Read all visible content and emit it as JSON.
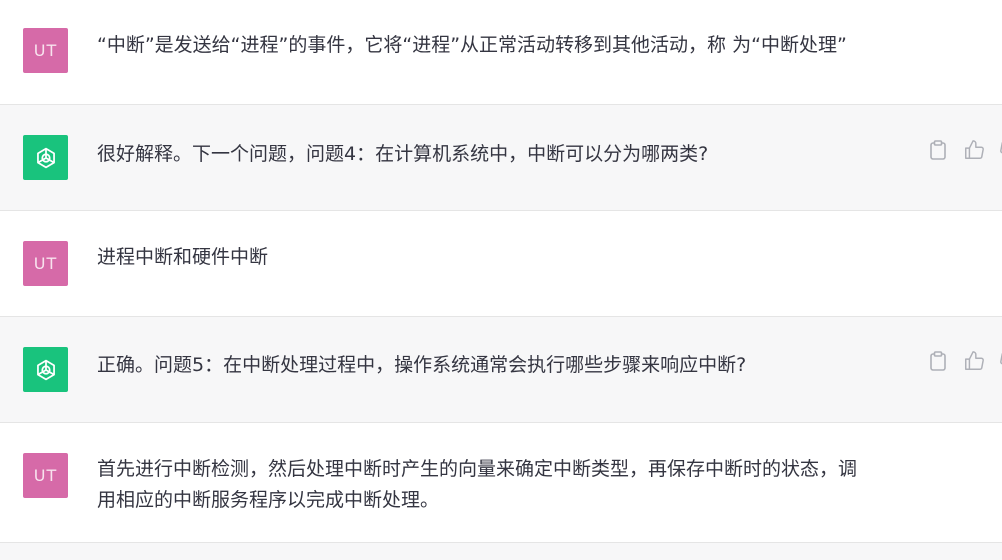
{
  "conversation": {
    "messages": [
      {
        "role": "user",
        "avatar_initials": "UT",
        "text": "“中断”是发送给“进程”的事件，它将“进程”从正常活动转移到其他活动，称 为“中断处理”"
      },
      {
        "role": "assistant",
        "avatar_icon": "openai-logo-icon",
        "text": "很好解释。下一个问题，问题4：在计算机系统中，中断可以分为哪两类?"
      },
      {
        "role": "user",
        "avatar_initials": "UT",
        "text": "进程中断和硬件中断"
      },
      {
        "role": "assistant",
        "avatar_icon": "openai-logo-icon",
        "text": "正确。问题5：在中断处理过程中，操作系统通常会执行哪些步骤来响应中断?"
      },
      {
        "role": "user",
        "avatar_initials": "UT",
        "text": "首先进行中断检测，然后处理中断时产生的向量来确定中断类型，再保存中断时的状态，调\n用相应的中断服务程序以完成中断处理。"
      }
    ]
  },
  "icons": {
    "copy": "clipboard-icon",
    "like": "thumbs-up-icon",
    "dislike": "thumbs-down-icon"
  },
  "colors": {
    "user_avatar": "#d66aa8",
    "assistant_avatar": "#19c37d",
    "assistant_row_bg": "#f7f7f8"
  }
}
